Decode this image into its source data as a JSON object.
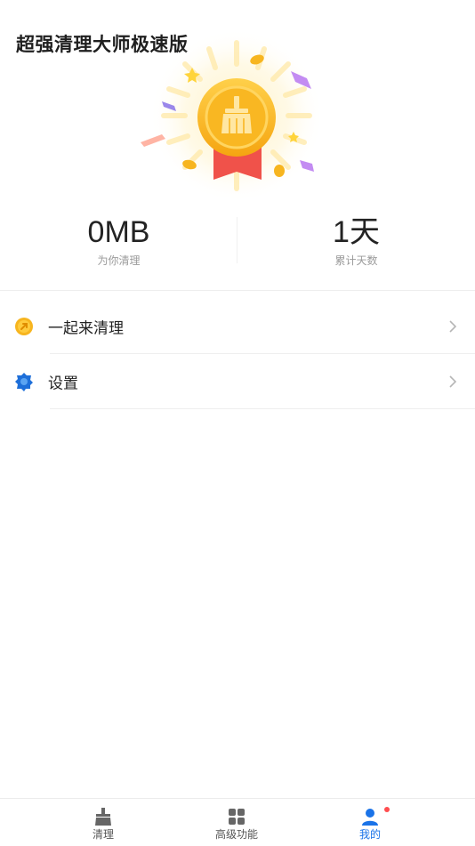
{
  "header": {
    "title": "超强清理大师极速版"
  },
  "medal": {
    "icon": "broom-icon",
    "colors": {
      "gold": "#f7b51f",
      "gold_light": "#ffd34d",
      "ribbon": "#f0524a"
    }
  },
  "stats": [
    {
      "value": "0MB",
      "label": "为你清理"
    },
    {
      "value": "1天",
      "label": "累计天数"
    }
  ],
  "menu": {
    "items": [
      {
        "label": "一起来清理",
        "icon": "coin-icon"
      },
      {
        "label": "设置",
        "icon": "gear-icon"
      }
    ]
  },
  "bottom_nav": {
    "items": [
      {
        "label": "清理",
        "icon": "broom-icon"
      },
      {
        "label": "高级功能",
        "icon": "grid-icon"
      },
      {
        "label": "我的",
        "icon": "user-icon",
        "active": true
      }
    ]
  },
  "colors": {
    "accent": "#1a73e8",
    "badge": "#ff4d4f"
  }
}
